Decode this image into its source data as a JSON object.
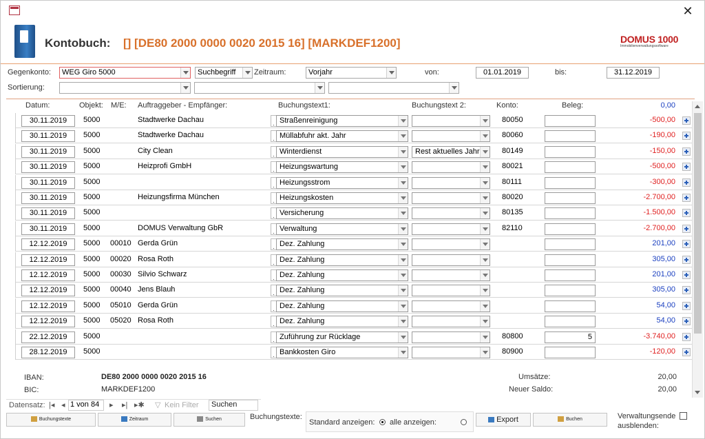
{
  "window": {
    "close_glyph": "✕"
  },
  "header": {
    "label": "Kontobuch:",
    "title": "[] [DE80 2000 0000 0020 2015 16] [MARKDEF1200]",
    "logo_main": "DOMUS 1000",
    "logo_sub": "Immobilienverwaltungssoftware"
  },
  "filters": {
    "gegenkonto_label": "Gegenkonto:",
    "gegenkonto_value": "WEG Giro 5000",
    "suchbegriff_value": "Suchbegriff",
    "zeitraum_label": "Zeitraum:",
    "zeitraum_value": "Vorjahr",
    "von_label": "von:",
    "von_value": "01.01.2019",
    "bis_label": "bis:",
    "bis_value": "31.12.2019",
    "sortierung_label": "Sortierung:"
  },
  "columns": {
    "datum": "Datum:",
    "objekt": "Objekt:",
    "me": "M/E:",
    "auftraggeber": "Auftraggeber - Empfänger:",
    "bt1": "Buchungstext1:",
    "bt2": "Buchungstext 2:",
    "konto": "Konto:",
    "beleg": "Beleg:",
    "header_total": "0,00"
  },
  "rows": [
    {
      "datum": "30.11.2019",
      "objekt": "5000",
      "me": "",
      "auftraggeber": "Stadtwerke Dachau",
      "bt1": "Straßenreinigung",
      "bt2": "",
      "konto": "80050",
      "beleg": "",
      "betrag": "-500,00",
      "sign": "neg"
    },
    {
      "datum": "30.11.2019",
      "objekt": "5000",
      "me": "",
      "auftraggeber": "Stadtwerke Dachau",
      "bt1": "Müllabfuhr akt. Jahr",
      "bt2": "",
      "konto": "80060",
      "beleg": "",
      "betrag": "-190,00",
      "sign": "neg"
    },
    {
      "datum": "30.11.2019",
      "objekt": "5000",
      "me": "",
      "auftraggeber": "City Clean",
      "bt1": "Winterdienst",
      "bt2": "Rest aktuelles Jahr",
      "konto": "80149",
      "beleg": "",
      "betrag": "-150,00",
      "sign": "neg"
    },
    {
      "datum": "30.11.2019",
      "objekt": "5000",
      "me": "",
      "auftraggeber": "Heizprofi GmbH",
      "bt1": "Heizungswartung",
      "bt2": "",
      "konto": "80021",
      "beleg": "",
      "betrag": "-500,00",
      "sign": "neg"
    },
    {
      "datum": "30.11.2019",
      "objekt": "5000",
      "me": "",
      "auftraggeber": "",
      "bt1": "Heizungsstrom",
      "bt2": "",
      "konto": "80111",
      "beleg": "",
      "betrag": "-300,00",
      "sign": "neg"
    },
    {
      "datum": "30.11.2019",
      "objekt": "5000",
      "me": "",
      "auftraggeber": "Heizungsfirma München",
      "bt1": "Heizungskosten",
      "bt2": "",
      "konto": "80020",
      "beleg": "",
      "betrag": "-2.700,00",
      "sign": "neg"
    },
    {
      "datum": "30.11.2019",
      "objekt": "5000",
      "me": "",
      "auftraggeber": "",
      "bt1": "Versicherung",
      "bt2": "",
      "konto": "80135",
      "beleg": "",
      "betrag": "-1.500,00",
      "sign": "neg"
    },
    {
      "datum": "30.11.2019",
      "objekt": "5000",
      "me": "",
      "auftraggeber": "DOMUS Verwaltung GbR",
      "bt1": "Verwaltung",
      "bt2": "",
      "konto": "82110",
      "beleg": "",
      "betrag": "-2.700,00",
      "sign": "neg"
    },
    {
      "datum": "12.12.2019",
      "objekt": "5000",
      "me": "00010",
      "auftraggeber": "Gerda Grün",
      "bt1": "Dez. Zahlung",
      "bt2": "",
      "konto": "",
      "beleg": "",
      "betrag": "201,00",
      "sign": "pos"
    },
    {
      "datum": "12.12.2019",
      "objekt": "5000",
      "me": "00020",
      "auftraggeber": "Rosa Roth",
      "bt1": "Dez. Zahlung",
      "bt2": "",
      "konto": "",
      "beleg": "",
      "betrag": "305,00",
      "sign": "pos"
    },
    {
      "datum": "12.12.2019",
      "objekt": "5000",
      "me": "00030",
      "auftraggeber": "Silvio Schwarz",
      "bt1": "Dez. Zahlung",
      "bt2": "",
      "konto": "",
      "beleg": "",
      "betrag": "201,00",
      "sign": "pos"
    },
    {
      "datum": "12.12.2019",
      "objekt": "5000",
      "me": "00040",
      "auftraggeber": "Jens Blauh",
      "bt1": "Dez. Zahlung",
      "bt2": "",
      "konto": "",
      "beleg": "",
      "betrag": "305,00",
      "sign": "pos"
    },
    {
      "datum": "12.12.2019",
      "objekt": "5000",
      "me": "05010",
      "auftraggeber": "Gerda Grün",
      "bt1": "Dez. Zahlung",
      "bt2": "",
      "konto": "",
      "beleg": "",
      "betrag": "54,00",
      "sign": "pos"
    },
    {
      "datum": "12.12.2019",
      "objekt": "5000",
      "me": "05020",
      "auftraggeber": "Rosa Roth",
      "bt1": "Dez. Zahlung",
      "bt2": "",
      "konto": "",
      "beleg": "",
      "betrag": "54,00",
      "sign": "pos"
    },
    {
      "datum": "22.12.2019",
      "objekt": "5000",
      "me": "",
      "auftraggeber": "",
      "bt1": "Zuführung zur Rücklage",
      "bt2": "",
      "konto": "80800",
      "beleg": "5",
      "betrag": "-3.740,00",
      "sign": "neg"
    },
    {
      "datum": "28.12.2019",
      "objekt": "5000",
      "me": "",
      "auftraggeber": "",
      "bt1": "Bankkosten Giro",
      "bt2": "",
      "konto": "80900",
      "beleg": "",
      "betrag": "-120,00",
      "sign": "neg"
    }
  ],
  "footer": {
    "iban_label": "IBAN:",
    "iban_value": "DE80 2000 0000 0020 2015 16",
    "bic_label": "BIC:",
    "bic_value": "MARKDEF1200",
    "umsaetze_label": "Umsätze:",
    "umsaetze_value": "20,00",
    "saldo_label": "Neuer Saldo:",
    "saldo_value": "20,00"
  },
  "navbar": {
    "label": "Datensatz:",
    "first": "|◂",
    "prev": "◂",
    "record": "1 von 84",
    "next": "▸",
    "last": "▸|",
    "new": "▸✱",
    "filter": "Kein Filter",
    "search": "Suchen"
  },
  "buttons": {
    "buchungstexte": "Buchungstexte",
    "zeitraum": "Zeitraum",
    "suchen": "Suchen",
    "buchungstexte_label": "Buchungstexte:",
    "standard": "Standard anzeigen:",
    "alle": "alle anzeigen:",
    "export": "Export",
    "buchen": "Buchen",
    "verwaltung": "Verwaltungsende",
    "ausblenden": "ausblenden:"
  }
}
